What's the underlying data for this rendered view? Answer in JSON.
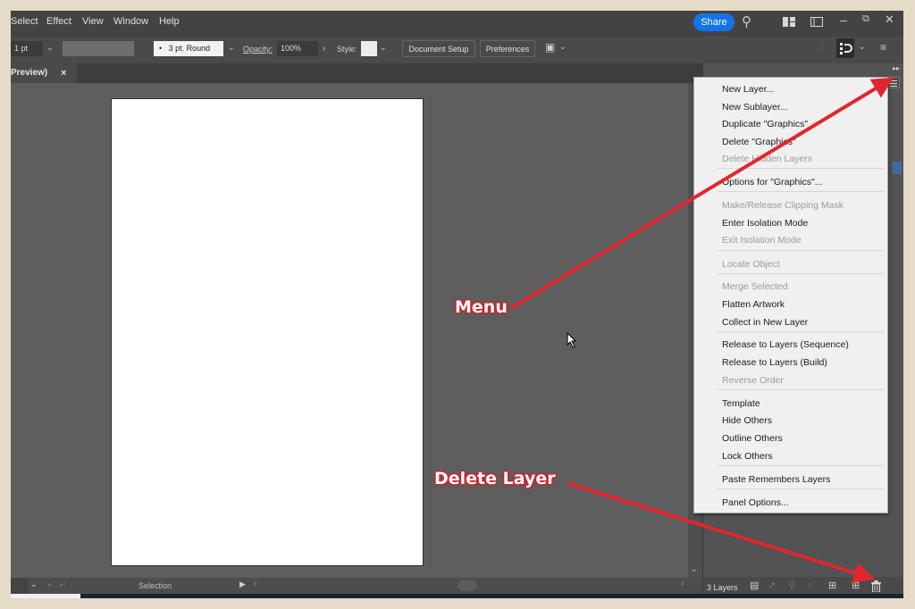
{
  "menubar": {
    "items": [
      "Select",
      "Effect",
      "View",
      "Window",
      "Help"
    ],
    "share_label": "Share"
  },
  "controlbar": {
    "stroke_weight": "1 pt",
    "brush": "3 pt. Round",
    "opacity_label": "Opacity:",
    "opacity_value": "100%",
    "style_label": "Style:",
    "document_setup": "Document Setup",
    "preferences": "Preferences"
  },
  "document": {
    "tab_label": "Preview)",
    "tab_close": "×"
  },
  "statusbar": {
    "tool": "Selection"
  },
  "layers_panel": {
    "count_label": "3 Layers"
  },
  "panel_menu": {
    "items": [
      {
        "label": "New Layer...",
        "enabled": true
      },
      {
        "label": "New Sublayer...",
        "enabled": true
      },
      {
        "label": "Duplicate \"Graphics\"",
        "enabled": true
      },
      {
        "label": "Delete \"Graphics\"",
        "enabled": true
      },
      {
        "label": "Delete Hidden Layers",
        "enabled": false
      },
      {
        "label": "Options for \"Graphics\"...",
        "enabled": true
      },
      {
        "label": "Make/Release Clipping Mask",
        "enabled": false
      },
      {
        "label": "Enter Isolation Mode",
        "enabled": true
      },
      {
        "label": "Exit Isolation Mode",
        "enabled": false
      },
      {
        "label": "Locate Object",
        "enabled": false
      },
      {
        "label": "Merge Selected",
        "enabled": false
      },
      {
        "label": "Flatten Artwork",
        "enabled": true
      },
      {
        "label": "Collect in New Layer",
        "enabled": true
      },
      {
        "label": "Release to Layers (Sequence)",
        "enabled": true
      },
      {
        "label": "Release to Layers (Build)",
        "enabled": true
      },
      {
        "label": "Reverse Order",
        "enabled": false
      },
      {
        "label": "Template",
        "enabled": true
      },
      {
        "label": "Hide Others",
        "enabled": true
      },
      {
        "label": "Outline Others",
        "enabled": true
      },
      {
        "label": "Lock Others",
        "enabled": true
      },
      {
        "label": "Paste Remembers Layers",
        "enabled": true
      },
      {
        "label": "Panel Options...",
        "enabled": true
      }
    ]
  },
  "annotations": {
    "menu_label": "Menu",
    "delete_label": "Delete Layer",
    "color": "#d3232a"
  },
  "colors": {
    "accent": "#1473e6",
    "canvas": "#5e5e5e",
    "artboard": "#ffffff"
  }
}
